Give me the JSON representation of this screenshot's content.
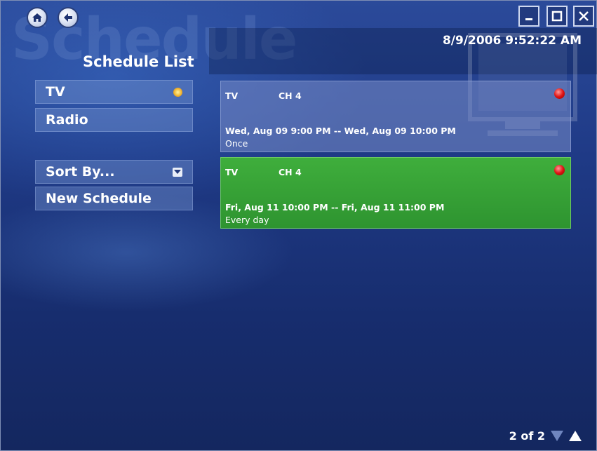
{
  "background_watermark": "Schedule",
  "page_title": "Schedule List",
  "clock": "8/9/2006 9:52:22 AM",
  "nav": {
    "home_icon": "home-icon",
    "back_icon": "back-arrow-icon"
  },
  "window_controls": {
    "minimize": "minimize-icon",
    "maximize": "maximize-icon",
    "close": "close-icon"
  },
  "menu": [
    {
      "label": "TV",
      "icon": "selected-indicator-icon"
    },
    {
      "label": "Radio"
    },
    {
      "label": "Sort By...",
      "icon": "dropdown-icon"
    },
    {
      "label": "New Schedule"
    }
  ],
  "schedules": [
    {
      "source": "TV",
      "channel": "CH 4",
      "time": "Wed, Aug 09 9:00 PM -- Wed, Aug 09 10:00 PM",
      "recurrence": "Once",
      "status_color": "#e01414"
    },
    {
      "source": "TV",
      "channel": "CH 4",
      "time": "Fri, Aug 11 10:00 PM -- Fri, Aug 11 11:00 PM",
      "recurrence": "Every day",
      "status_color": "#e01414"
    }
  ],
  "pager": {
    "text": "2 of 2"
  },
  "colors": {
    "background": "#1f3a86",
    "selected_card": "#3fae3c"
  }
}
